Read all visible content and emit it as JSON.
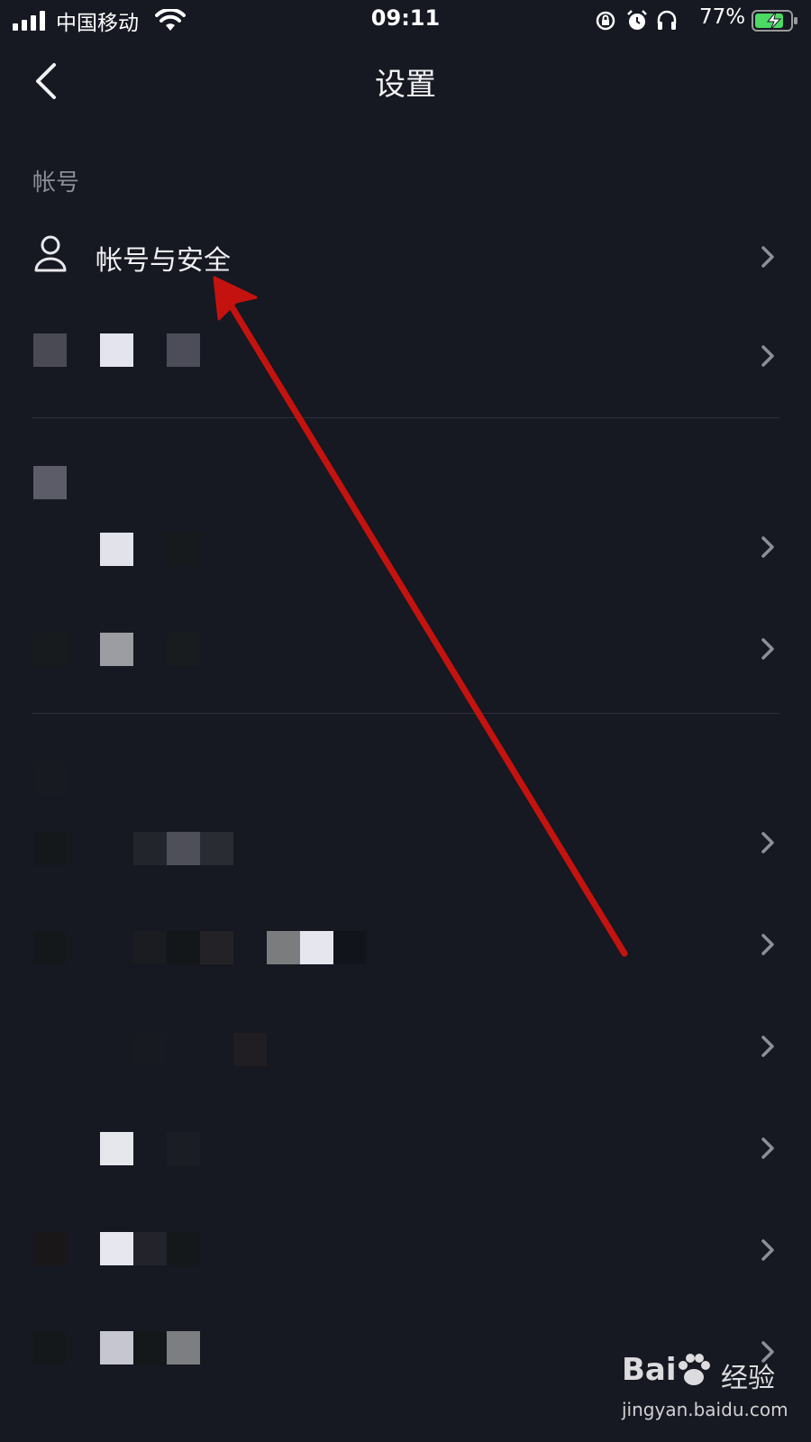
{
  "status_bar": {
    "carrier": "中国移动",
    "time": "09:11",
    "battery": "77%",
    "icons": [
      "signal-icon",
      "wifi-icon",
      "orientation-lock-icon",
      "alarm-icon",
      "headphones-icon",
      "battery-charging-icon"
    ]
  },
  "nav": {
    "title": "设置",
    "back_icon": "back-chevron-icon"
  },
  "sections": [
    {
      "label": "帐号",
      "items": [
        {
          "label": "帐号与安全",
          "icon": "user-icon"
        }
      ]
    }
  ],
  "colors": {
    "background": "#161822",
    "text": "#f2f2f4",
    "section_label": "#8b8d96",
    "annotation_arrow": "#c4130f"
  },
  "watermark": {
    "logo": "Bai",
    "cn": "经验",
    "url": "jingyan.baidu.com"
  }
}
